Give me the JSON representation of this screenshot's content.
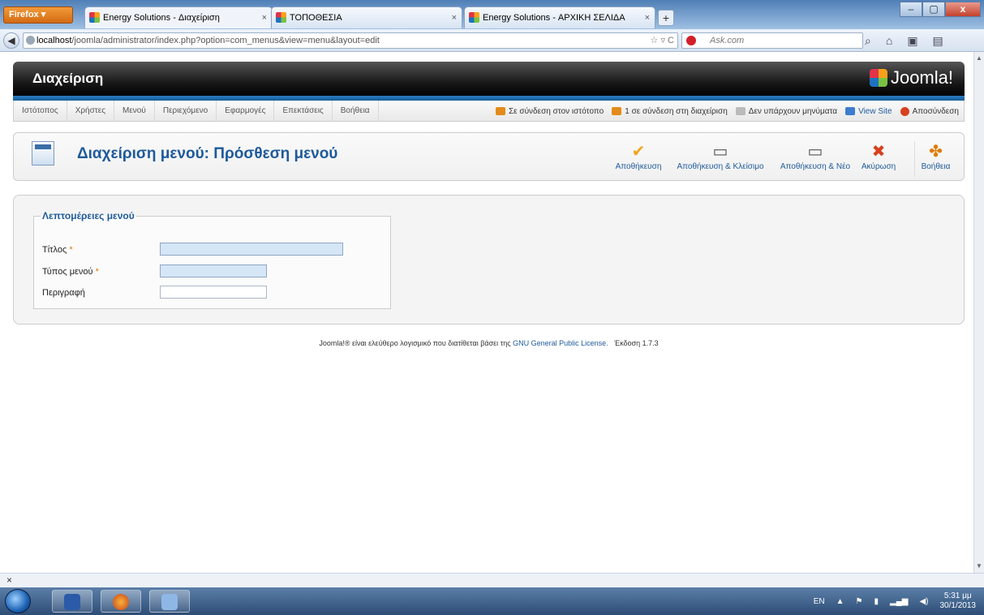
{
  "browser": {
    "menu_button": "Firefox ▾",
    "tabs": [
      {
        "title": "Energy Solutions - Διαχείριση",
        "close": "×"
      },
      {
        "title": "ΤΟΠΟΘΕΣΙΑ",
        "close": "×"
      },
      {
        "title": "Energy Solutions - ΑΡΧΙΚΗ ΣΕΛΙΔΑ",
        "close": "×"
      }
    ],
    "new_tab": "+",
    "url_host": "localhost",
    "url_path": "/joomla/administrator/index.php?option=com_menus&view=menu&layout=edit",
    "url_tools": "☆ ▿ C",
    "search_placeholder": "Ask.com",
    "window_buttons": {
      "min": "–",
      "max": "▢",
      "close": "x"
    }
  },
  "header": {
    "title": "Διαχείριση",
    "logo_text": "Joomla!"
  },
  "menu": [
    "Ιστότοπος",
    "Χρήστες",
    "Μενού",
    "Περιεχόμενο",
    "Εφαρμογές",
    "Επεκτάσεις",
    "Βοήθεια"
  ],
  "status": {
    "online_site": "Σε σύνδεση στον ιστότοπο",
    "online_admin": "1 σε σύνδεση στη διαχείριση",
    "messages": "Δεν υπάρχουν μηνύματα",
    "view_site": "View Site",
    "logout": "Αποσύνδεση"
  },
  "toolbar": {
    "page_title": "Διαχείριση μενού: Πρόσθεση μενού",
    "save": "Αποθήκευση",
    "save_close": "Αποθήκευση & Κλείσιμο",
    "save_new": "Αποθήκευση & Νέο",
    "cancel": "Ακύρωση",
    "help": "Βοήθεια"
  },
  "form": {
    "legend": "Λεπτομέρειες μενού",
    "title_label": "Τίτλος",
    "type_label": "Τύπος μενού",
    "description_label": "Περιγραφή",
    "required_mark": "*",
    "title_value": "",
    "type_value": "",
    "description_value": ""
  },
  "footer": {
    "text_prefix": "Joomla!® είναι ελεύθερο λογισμικό που διατίθεται βάσει της",
    "license_link": "GNU General Public License.",
    "version": "Έκδοση 1.7.3"
  },
  "closebar": {
    "close": "×"
  },
  "taskbar": {
    "lang": "EN",
    "time": "5:31 μμ",
    "date": "30/1/2013"
  }
}
